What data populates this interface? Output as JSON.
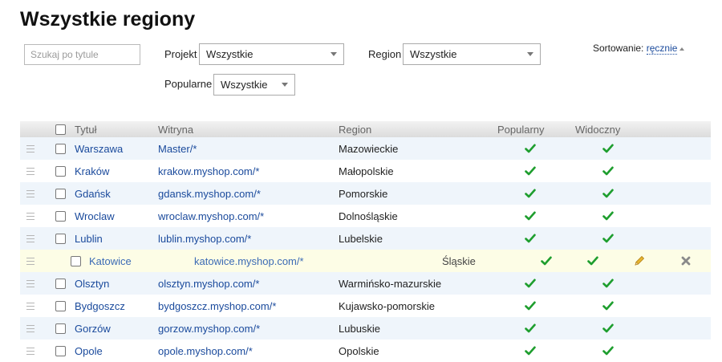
{
  "page": {
    "title": "Wszystkie regiony"
  },
  "filters": {
    "search_placeholder": "Szukaj po tytule",
    "project_label": "Projekt",
    "project_value": "Wszystkie",
    "region_label": "Region",
    "region_value": "Wszystkie",
    "popular_label": "Popularne",
    "popular_value": "Wszystkie"
  },
  "sort": {
    "label": "Sortowanie:",
    "value": "ręcznie"
  },
  "table": {
    "columns": [
      "Tytuł",
      "Witryna",
      "Region",
      "Popularny",
      "Widoczny"
    ],
    "rows": [
      {
        "title": "Warszawa",
        "site": "Master/*",
        "region": "Mazowieckie",
        "popular": true,
        "visible": true
      },
      {
        "title": "Kraków",
        "site": "krakow.myshop.com/*",
        "region": "Małopolskie",
        "popular": true,
        "visible": true
      },
      {
        "title": "Gdańsk",
        "site": "gdansk.myshop.com/*",
        "region": "Pomorskie",
        "popular": true,
        "visible": true
      },
      {
        "title": "Wroclaw",
        "site": "wroclaw.myshop.com/*",
        "region": "Dolnośląskie",
        "popular": true,
        "visible": true
      },
      {
        "title": "Lublin",
        "site": "lublin.myshop.com/*",
        "region": "Lubelskie",
        "popular": true,
        "visible": true
      },
      {
        "title": "Katowice",
        "site": "katowice.myshop.com/*",
        "region": "Śląskie",
        "popular": true,
        "visible": true
      },
      {
        "title": "Olsztyn",
        "site": "olsztyn.myshop.com/*",
        "region": "Warmińsko-mazurskie",
        "popular": true,
        "visible": true
      },
      {
        "title": "Bydgoszcz",
        "site": "bydgoszcz.myshop.com/*",
        "region": "Kujawsko-pomorskie",
        "popular": true,
        "visible": true
      },
      {
        "title": "Gorzów",
        "site": "gorzow.myshop.com/*",
        "region": "Lubuskie",
        "popular": true,
        "visible": true
      },
      {
        "title": "Opole",
        "site": "opole.myshop.com/*",
        "region": "Opolskie",
        "popular": true,
        "visible": true
      }
    ]
  },
  "icons": {
    "check": "check-icon",
    "edit": "pencil-icon",
    "delete": "close-icon",
    "drag": "drag-handle-icon"
  },
  "colors": {
    "link": "#1a4a9c",
    "check": "#1e9e2e",
    "row_alt": "#eff5fb",
    "row_highlight": "#fdfde6",
    "pencil": "#e8b530"
  }
}
